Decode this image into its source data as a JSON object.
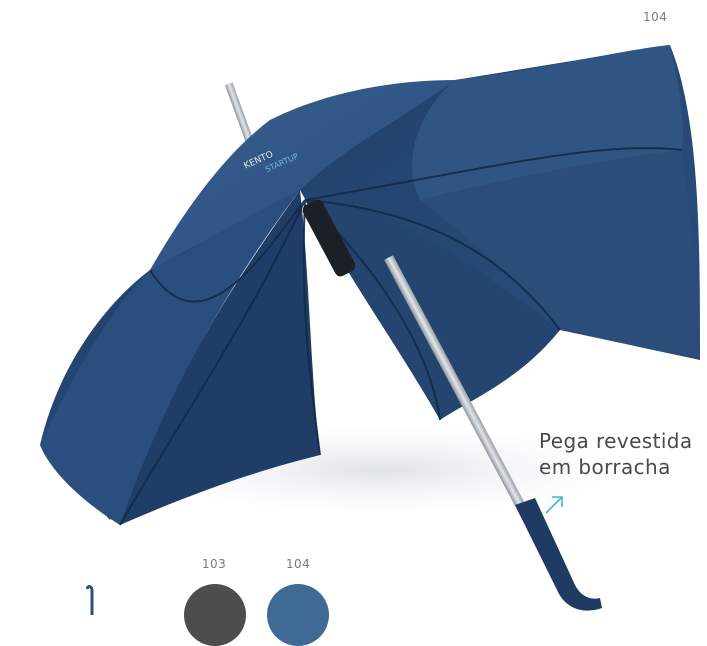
{
  "page": {
    "top_ref": "104"
  },
  "umbrella": {
    "brand_logo": "KENTO STARTUP",
    "canopy_color": "#2b4e7c",
    "canopy_dark": "#1d3a63",
    "shaft_color": "#b9bec3",
    "handle_color": "#1f3a63"
  },
  "callout": {
    "line1": "Pega revestida",
    "line2": "em borracha",
    "arrow_icon": "arrow-up-right-icon",
    "accent": "#3bb8c8"
  },
  "swatches": [
    {
      "code": "103",
      "color": "#4d4d4d"
    },
    {
      "code": "104",
      "color": "#3f6a96"
    }
  ]
}
